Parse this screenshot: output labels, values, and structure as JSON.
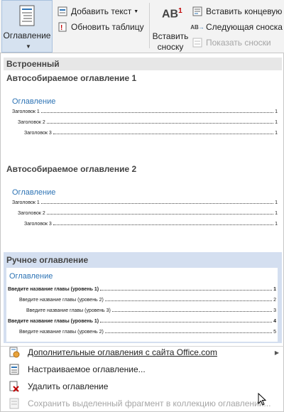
{
  "ribbon": {
    "toc_button": {
      "label": "Оглавление",
      "icon": "table-of-contents-icon"
    },
    "add_text": "Добавить текст",
    "update_table": "Обновить таблицу",
    "insert_footnote_line1": "Вставить",
    "insert_footnote_line2": "сноску",
    "insert_endnote": "Вставить концевую",
    "next_footnote": "Следующая сноска",
    "show_notes": "Показать сноски"
  },
  "gallery": {
    "header": "Встроенный",
    "items": [
      {
        "title": "Автособираемое оглавление 1",
        "preview_title": "Оглавление",
        "lines": [
          {
            "text": "Заголовок 1",
            "page": "1"
          },
          {
            "text": "Заголовок 2",
            "page": "1"
          },
          {
            "text": "Заголовок 3",
            "page": "1"
          }
        ]
      },
      {
        "title": "Автособираемое оглавление 2",
        "preview_title": "Оглавление",
        "lines": [
          {
            "text": "Заголовок 1",
            "page": "1"
          },
          {
            "text": "Заголовок 2",
            "page": "1"
          },
          {
            "text": "Заголовок 3",
            "page": "1"
          }
        ]
      },
      {
        "title": "Ручное оглавление",
        "preview_title": "Оглавление",
        "lines": [
          {
            "text": "Введите название главы (уровень 1)",
            "page": "1"
          },
          {
            "text": "Введите название главы (уровень 2)",
            "page": "2"
          },
          {
            "text": "Введите название главы (уровень 3)",
            "page": "3"
          },
          {
            "text": "Введите название главы (уровень 1)",
            "page": "4"
          },
          {
            "text": "Введите название главы (уровень 2)",
            "page": "5"
          }
        ]
      }
    ]
  },
  "menu": {
    "more_tocs": "Дополнительные оглавления с сайта Office.com",
    "custom_toc": "Настраиваемое оглавление...",
    "remove_toc": "Удалить оглавление",
    "save_selection": "Сохранить выделенный фрагмент в коллекцию оглавлений..."
  },
  "colors": {
    "accent_blue": "#2e74b5",
    "selected_bg": "#d4dff0",
    "toc_button_bg": "#d6e2f0"
  }
}
